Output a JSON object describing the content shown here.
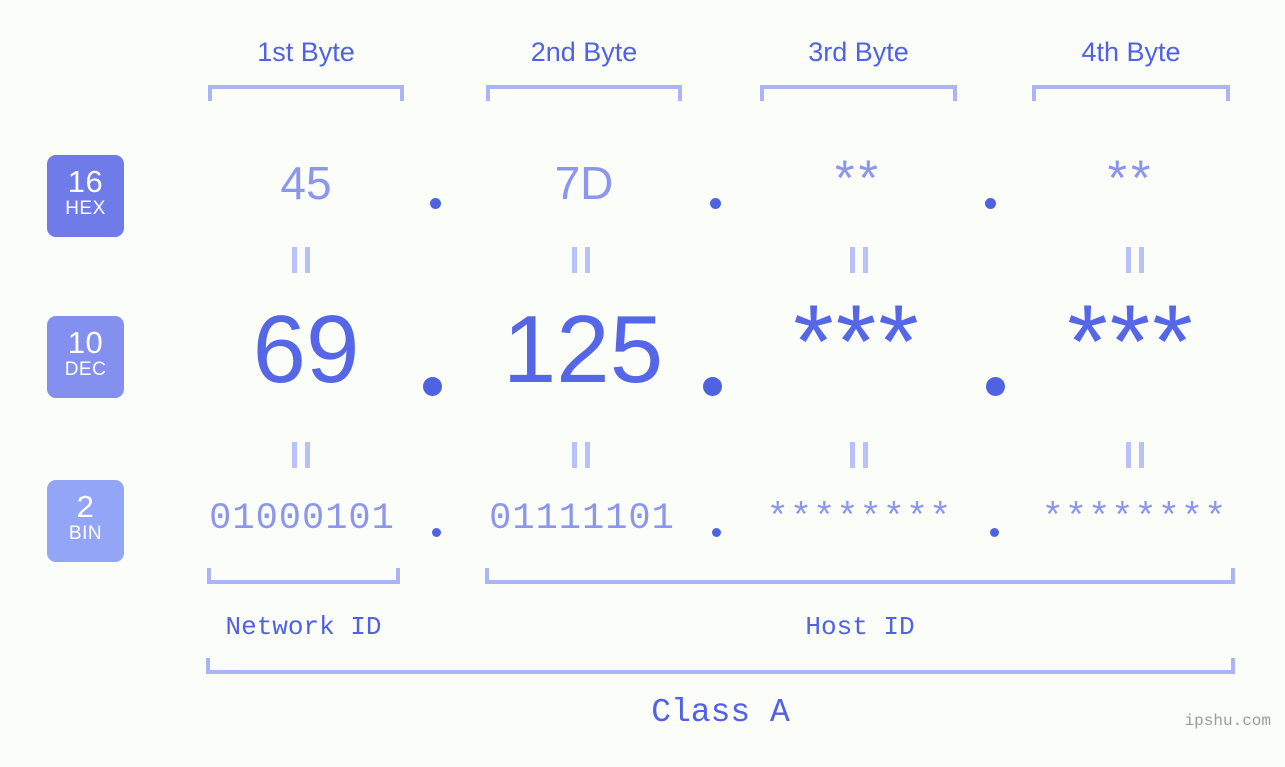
{
  "meta": {
    "watermark": "ipshu.com",
    "background_color": "#fbfdf8",
    "accent_strong": "#4f63e2",
    "accent_mid": "#5566e6",
    "accent_light": "#8c96ec",
    "accent_pale": "#aab4f7"
  },
  "headers": [
    {
      "label": "1st Byte"
    },
    {
      "label": "2nd Byte"
    },
    {
      "label": "3rd Byte"
    },
    {
      "label": "4th Byte"
    }
  ],
  "bases": [
    {
      "num": "16",
      "name": "HEX",
      "color": "#6f7be9"
    },
    {
      "num": "10",
      "name": "DEC",
      "color": "#8490ef"
    },
    {
      "num": "2",
      "name": "BIN",
      "color": "#93a5f7"
    }
  ],
  "rows": {
    "hex": {
      "base_num": "16",
      "base_name": "HEX",
      "values": [
        "45",
        "7D",
        "**",
        "**"
      ],
      "separator": "."
    },
    "dec": {
      "base_num": "10",
      "base_name": "DEC",
      "values": [
        "69",
        "125",
        "***",
        "***"
      ],
      "separator": "."
    },
    "bin": {
      "base_num": "2",
      "base_name": "BIN",
      "values": [
        "01000101",
        "01111101",
        "********",
        "********"
      ],
      "separator": "."
    }
  },
  "equals_marks": {
    "symbol": "||",
    "count_per_row": 4
  },
  "partitions": {
    "network_id": "Network ID",
    "host_id": "Host ID"
  },
  "class_label": "Class A"
}
